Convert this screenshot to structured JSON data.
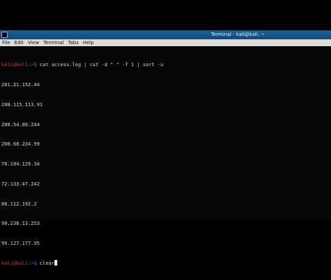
{
  "window": {
    "title": "Terminal - kali@kali: ~"
  },
  "menu": [
    "File",
    "Edit",
    "View",
    "Terminal",
    "Tabs",
    "Help"
  ],
  "terminal": {
    "prompt_user": "kali@kali",
    "prompt_path": ":~$ ",
    "command1": "cat access.log | cut -d \" \" -f 1 | sort -u",
    "output": [
      "201.21.152.44",
      "208.115.113.91",
      "208.54.80.244",
      "208.68.234.99",
      "70.194.129.34",
      "72.133.47.242",
      "88.112.192.2",
      "98.238.13.253",
      "99.127.177.95"
    ],
    "command2": "clear"
  },
  "colors": {
    "titlebar": "#1d5f95",
    "prompt_user": "#e03030",
    "prompt_path": "#4f79d8",
    "background": "#050505"
  }
}
